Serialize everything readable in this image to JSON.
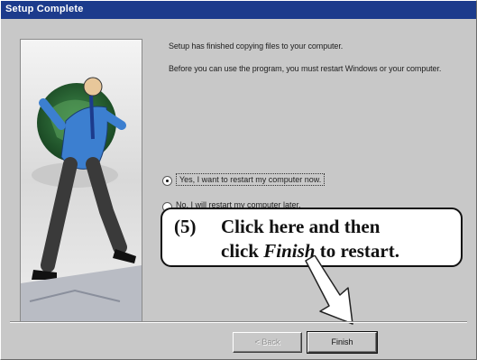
{
  "window": {
    "title": "Setup Complete"
  },
  "message": {
    "line1": "Setup has finished copying files to your computer.",
    "line2": "Before you can use the program, you must restart Windows or your computer."
  },
  "options": [
    {
      "label": "Yes, I want to restart my computer now.",
      "selected": true
    },
    {
      "label": "No, I will restart my computer later.",
      "selected": false
    }
  ],
  "callout": {
    "number": "(5)",
    "line1": "Click here and then",
    "line2_pre": "click ",
    "line2_em": "Finish",
    "line2_post": " to restart."
  },
  "buttons": {
    "back": "< Back",
    "finish": "Finish"
  },
  "colors": {
    "titlebar": "#1c3b8c",
    "dialog": "#c8c8c8"
  }
}
